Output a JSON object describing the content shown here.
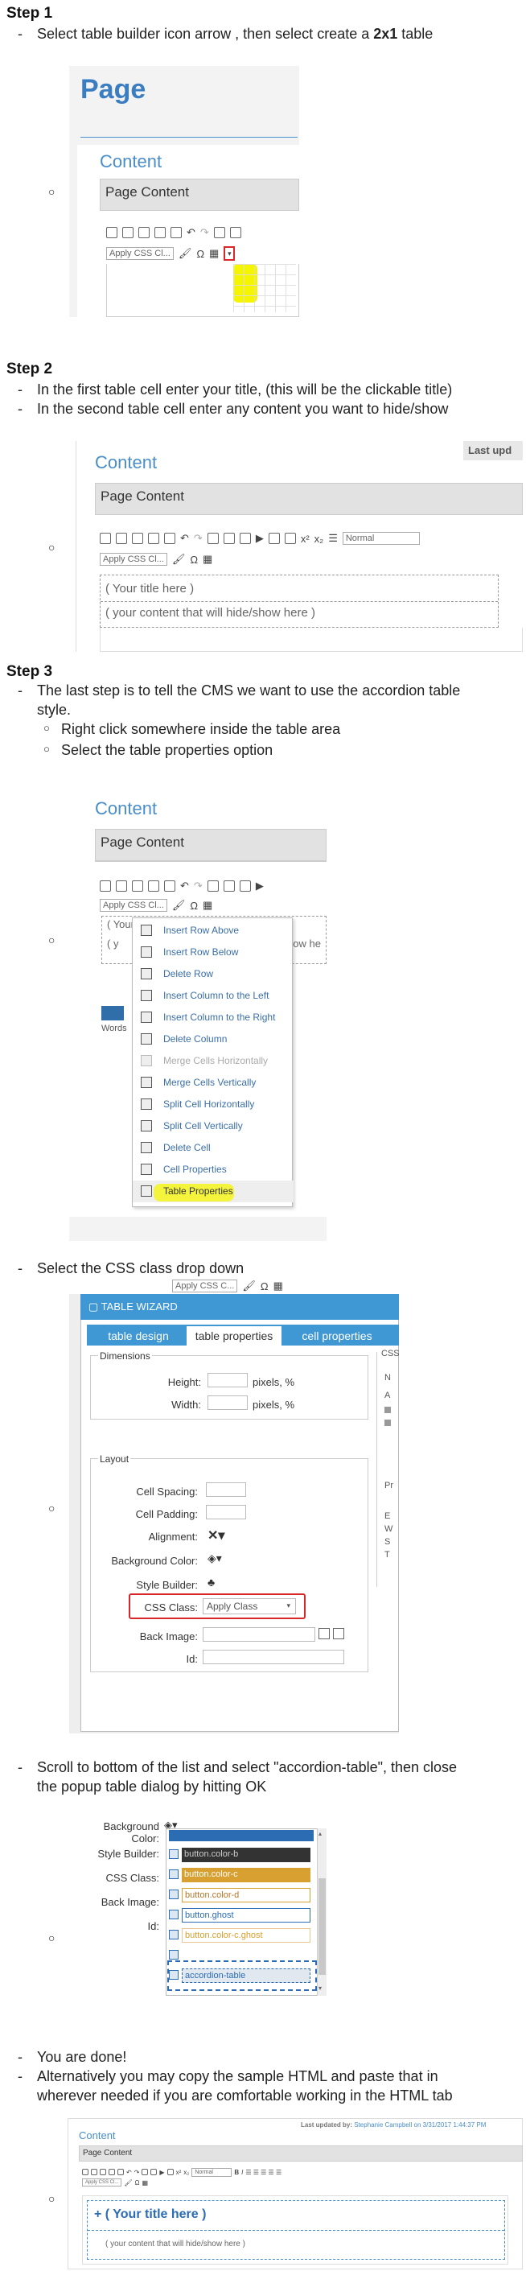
{
  "step1": {
    "heading": "Step 1",
    "line_a": "Select table builder icon arrow , then select create a ",
    "line_b": "2x1",
    "line_c": " table",
    "shot": {
      "page_title": "Page",
      "content_label": "Content",
      "bar_label": "Page Content",
      "css_select": "Apply CSS Cl..."
    }
  },
  "step2": {
    "heading": "Step 2",
    "line1": "In the first table cell enter your title, (this will be the clickable title)",
    "line2": "In the second table cell enter any content you want to hide/show",
    "shot": {
      "content_label": "Content",
      "last_upd": "Last upd",
      "bar_label": "Page Content",
      "format_select": "Normal",
      "css_select": "Apply CSS Cl...",
      "cell1": "( Your title here )",
      "cell2": "( your content that will hide/show here )"
    }
  },
  "step3": {
    "heading": "Step 3",
    "line1": "The last step is to tell the CMS we want to use the accordion table",
    "line1b": "style.",
    "sub1": "Right click somewhere inside the table area",
    "sub2": "Select the table properties option",
    "shot": {
      "content_label": "Content",
      "bar_label": "Page Content",
      "css_select": "Apply CSS Cl...",
      "cell1_peek": "( Your title here )",
      "cell2_peek": "( y",
      "cell2_right": "ow he",
      "words": "Words",
      "menu": [
        {
          "label": "Insert Row Above",
          "disabled": false
        },
        {
          "label": "Insert Row Below",
          "disabled": false
        },
        {
          "label": "Delete Row",
          "disabled": false
        },
        {
          "label": "Insert Column to the Left",
          "disabled": false
        },
        {
          "label": "Insert Column to the Right",
          "disabled": false
        },
        {
          "label": "Delete Column",
          "disabled": false
        },
        {
          "label": "Merge Cells Horizontally",
          "disabled": true
        },
        {
          "label": "Merge Cells Vertically",
          "disabled": false
        },
        {
          "label": "Split Cell Horizontally",
          "disabled": false
        },
        {
          "label": "Split Cell Vertically",
          "disabled": false
        },
        {
          "label": "Delete Cell",
          "disabled": false
        },
        {
          "label": "Cell Properties",
          "disabled": false
        },
        {
          "label": "Table Properties",
          "disabled": false
        }
      ]
    }
  },
  "step4": {
    "line": "Select the CSS class drop down",
    "shot": {
      "top_css": "Apply CSS C...",
      "wizard_title": "TABLE WIZARD",
      "tabs": [
        "table design",
        "table properties",
        "cell properties"
      ],
      "css_peek": "CSS",
      "dimensions": "Dimensions",
      "height": "Height:",
      "width": "Width:",
      "pixels": "pixels, %",
      "layout": "Layout",
      "cell_spacing": "Cell Spacing:",
      "cell_padding": "Cell Padding:",
      "alignment": "Alignment:",
      "background_color": "Background Color:",
      "style_builder": "Style Builder:",
      "css_class": "CSS Class:",
      "apply_class": "Apply Class",
      "back_image": "Back Image:",
      "id": "Id:",
      "peek_n": "N",
      "peek_a": "A",
      "peek_pr": "Pr",
      "peek_e": "E",
      "peek_w": "W",
      "peek_s": "S",
      "peek_t": "T"
    }
  },
  "step5": {
    "line1": "Scroll to bottom of the list and select \"accordion-table\", then close",
    "line2": "the popup table dialog by hitting OK",
    "shot": {
      "background_color": "Background Color:",
      "style_builder": "Style Builder:",
      "css_class": "CSS Class:",
      "back_image": "Back Image:",
      "id": "Id:",
      "options": [
        "button.color-b",
        "button.color-c",
        "button.color-d",
        "button.ghost",
        "button.color-c.ghost",
        "",
        "accordion-table"
      ]
    }
  },
  "step6": {
    "line1": "You are done!",
    "line2": "Alternatively you may copy the sample HTML and paste that in",
    "line3": "wherever needed if you are comfortable working in the HTML tab",
    "shot": {
      "content_label": "Content",
      "last_updated_label": "Last updated by:",
      "last_updated_value": "Stephanie Campbell on 3/31/2017 1:44:37 PM",
      "bar_label": "Page Content",
      "format_select": "Normal",
      "title_cell": "( Your title here )",
      "content_cell": "( your content that will hide/show here )"
    }
  },
  "colors": {
    "accent": "#4a8ec9",
    "wizard_blue": "#3f97d4",
    "highlight": "#f5f500",
    "red": "#d9262b"
  }
}
